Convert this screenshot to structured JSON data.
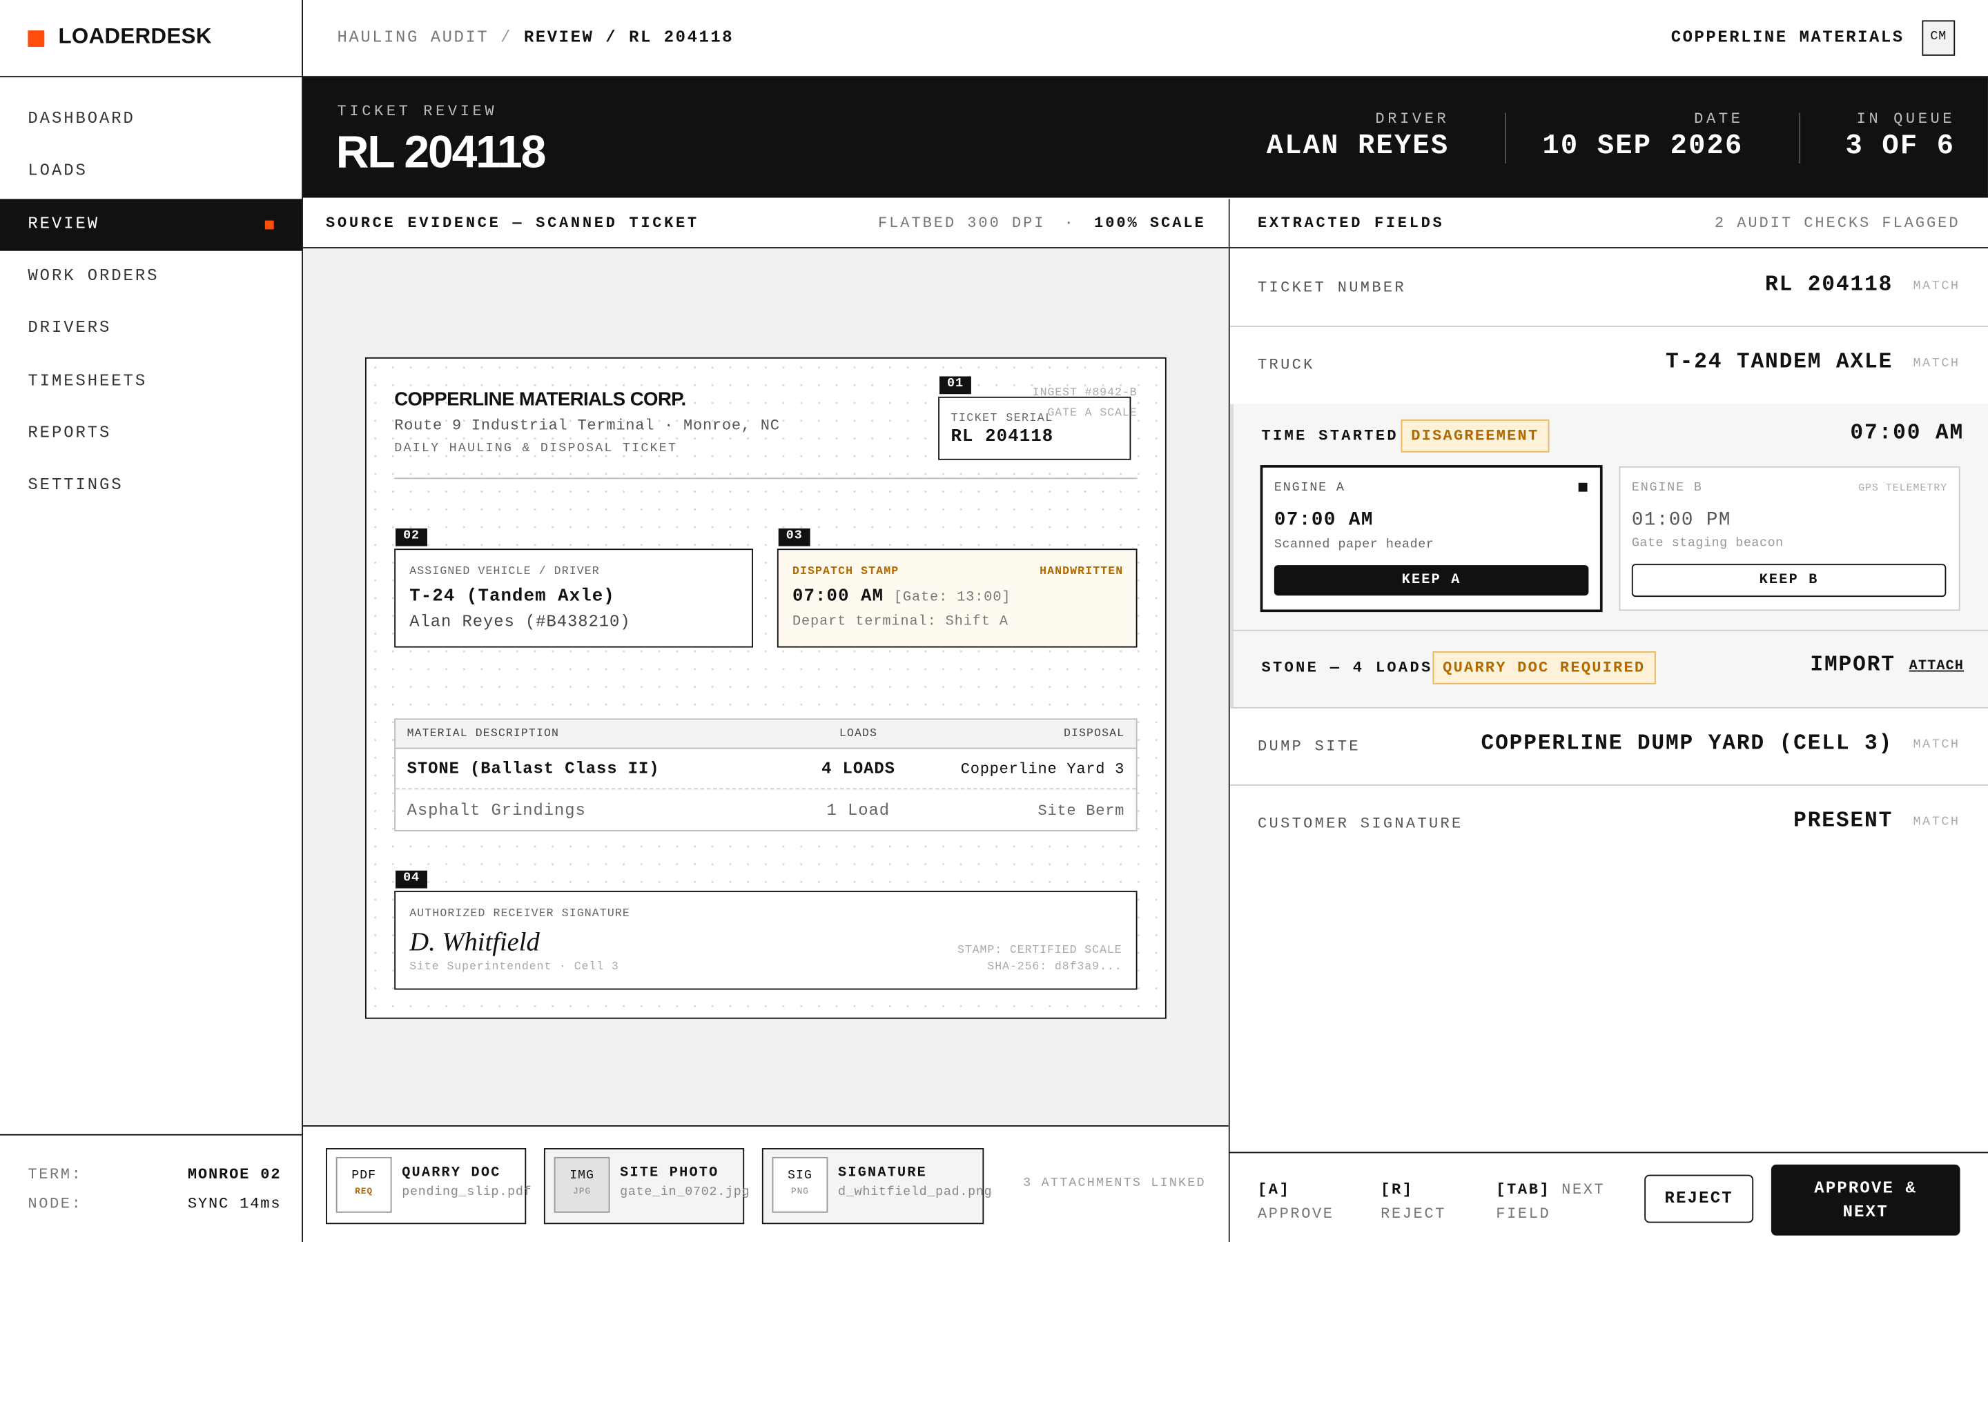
{
  "app": {
    "name": "LOADERDESK",
    "accent": "#ff4d0d"
  },
  "sidebar": {
    "items": [
      {
        "label": "DASHBOARD"
      },
      {
        "label": "LOADS"
      },
      {
        "label": "REVIEW"
      },
      {
        "label": "WORK ORDERS"
      },
      {
        "label": "DRIVERS"
      },
      {
        "label": "TIMESHEETS"
      },
      {
        "label": "REPORTS"
      },
      {
        "label": "SETTINGS"
      }
    ],
    "active_index": 2,
    "footer": {
      "term_label": "TERM:",
      "term_value": "MONROE 02",
      "node_label": "NODE:",
      "node_value": "SYNC 14ms"
    }
  },
  "topbar": {
    "crumb_root": "HAULING AUDIT",
    "crumb_sep": "/",
    "crumb_current": "REVIEW / RL 204118",
    "org": "COPPERLINE MATERIALS",
    "avatar": "CM"
  },
  "header": {
    "label": "TICKET REVIEW",
    "title": "RL 204118",
    "driver_label": "DRIVER",
    "driver_value": "ALAN REYES",
    "date_label": "DATE",
    "date_value": "10 SEP 2026",
    "queue_label": "IN QUEUE",
    "queue_value": "3 OF 6"
  },
  "evidence": {
    "title": "SOURCE EVIDENCE — SCANNED TICKET",
    "scan_info": "FLATBED 300 DPI",
    "dot": "·",
    "scale": "100% SCALE",
    "ticket": {
      "company": "COPPERLINE MATERIALS CORP.",
      "address": "Route 9 Industrial Terminal · Monroe, NC",
      "doc_type": "DAILY HAULING & DISPOSAL TICKET",
      "ingest": "INGEST #8942-B",
      "gate": "GATE A SCALE",
      "serial_tag": "01",
      "serial_label": "TICKET SERIAL",
      "serial_value": "RL 204118",
      "vehicle_tag": "02",
      "vehicle_label": "ASSIGNED VEHICLE / DRIVER",
      "vehicle_value": "T-24 (Tandem Axle)",
      "driver_value": "Alan Reyes (#B438210)",
      "stamp_tag": "03",
      "stamp_label": "DISPATCH STAMP",
      "stamp_note": "HANDWRITTEN",
      "stamp_time": "07:00 AM",
      "stamp_gate": "[Gate: 13:00]",
      "stamp_depart": "Depart terminal: Shift A",
      "table": {
        "headers": [
          "MATERIAL DESCRIPTION",
          "LOADS",
          "DISPOSAL"
        ],
        "rows": [
          [
            "STONE (Ballast Class II)",
            "4 LOADS",
            "Copperline Yard 3"
          ],
          [
            "Asphalt Grindings",
            "1 Load",
            "Site Berm"
          ]
        ]
      },
      "sig_tag": "04",
      "sig_label": "AUTHORIZED RECEIVER SIGNATURE",
      "sig_name": "D. Whitfield",
      "sig_role": "Site Superintendent · Cell 3",
      "sig_stamp": "STAMP: CERTIFIED SCALE",
      "sig_hash": "SHA-256: d8f3a9..."
    },
    "attachments": [
      {
        "type": "PDF",
        "sub": "REQ",
        "name": "QUARRY DOC",
        "file": "pending_slip.pdf"
      },
      {
        "type": "IMG",
        "sub": "JPG",
        "name": "SITE PHOTO",
        "file": "gate_in_0702.jpg"
      },
      {
        "type": "SIG",
        "sub": "PNG",
        "name": "SIGNATURE",
        "file": "d_whitfield_pad.png"
      }
    ],
    "attachments_note": "3 ATTACHMENTS LINKED"
  },
  "fields": {
    "title": "EXTRACTED FIELDS",
    "flag_note": "2 AUDIT CHECKS FLAGGED",
    "ticket_number": {
      "label": "TICKET NUMBER",
      "value": "RL 204118",
      "status": "MATCH"
    },
    "truck": {
      "label": "TRUCK",
      "value": "T-24 TANDEM AXLE",
      "status": "MATCH"
    },
    "time_started": {
      "label": "TIME STARTED",
      "badge": "DISAGREEMENT",
      "value": "07:00 AM",
      "engine_a": {
        "label": "ENGINE A",
        "value": "07:00 AM",
        "source": "Scanned paper header",
        "button": "KEEP A"
      },
      "engine_b": {
        "label": "ENGINE B",
        "note": "GPS TELEMETRY",
        "value": "01:00 PM",
        "source": "Gate staging beacon",
        "button": "KEEP B"
      }
    },
    "stone": {
      "label": "STONE — 4 LOADS",
      "badge": "QUARRY DOC REQUIRED",
      "value": "IMPORT",
      "link": "ATTACH"
    },
    "dump_site": {
      "label": "DUMP SITE",
      "value": "COPPERLINE DUMP YARD (CELL 3)",
      "status": "MATCH"
    },
    "signature": {
      "label": "CUSTOMER SIGNATURE",
      "value": "PRESENT",
      "status": "MATCH"
    }
  },
  "footer": {
    "approve_key": "[A]",
    "approve_text": "APPROVE",
    "reject_key": "[R]",
    "reject_text": "REJECT",
    "tab_key": "[TAB]",
    "tab_text_1": "NEXT",
    "tab_text_2": "FIELD",
    "reject_button": "REJECT",
    "approve_button_1": "APPROVE &",
    "approve_button_2": "NEXT"
  }
}
